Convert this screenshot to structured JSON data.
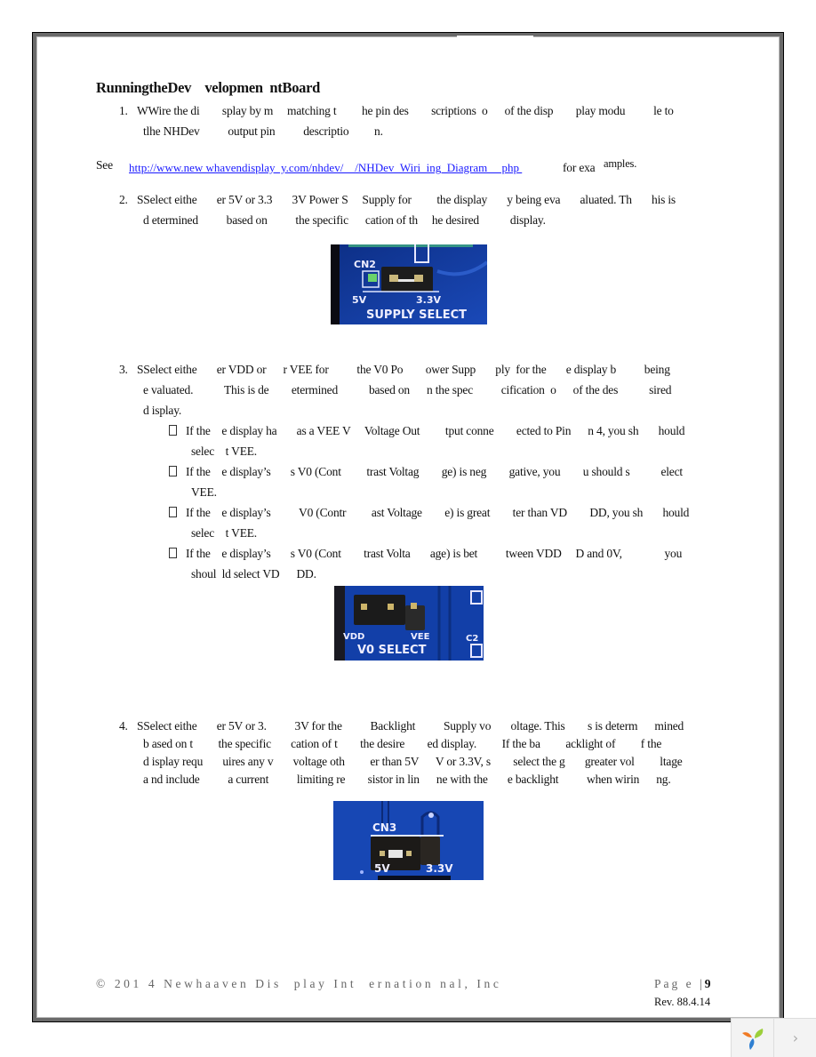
{
  "document": {
    "heading": "RunningtheDev    velopmen  ntBoard",
    "steps": [
      {
        "number": "1.",
        "lines": [
          "WWire the di        splay by m     matching t         he pin des        scriptions  o      of the disp        play modu          le to",
          "tlhe NHDev          output pin          descriptio         n."
        ]
      },
      {
        "number": "2.",
        "lines": [
          "SSelect eithe       er 5V or 3.3       3V Power S     Supply for         the display       y being eva       aluated. Th       his is",
          "d etermined          based on          the specific      cation of th     he desired           display."
        ]
      },
      {
        "number": "3.",
        "lines": [
          "SSelect eithe       er VDD or      r VEE for          the V0 Po        ower Supp       ply  for the       e display b          being",
          "e valuated.           This is de        etermined           based on      n the spec          cification  o      of the des           sired",
          "d isplay."
        ],
        "bullets": [
          {
            "lines": [
              "If the    e display ha       as a VEE V     Voltage Out         tput conne        ected to Pin      n 4, you sh       hould",
              "selec    t VEE."
            ]
          },
          {
            "lines": [
              "If the    e display’s       s V0 (Cont         trast Voltag        ge) is neg        gative, you        u should s           elect",
              "VEE."
            ]
          },
          {
            "lines": [
              "If the    e display’s          V0 (Contr         ast Voltage        e) is great        ter than VD        DD, you sh       hould",
              "selec    t VEE."
            ]
          },
          {
            "lines": [
              "If the    e display’s       s V0 (Cont        trast Volta       age) is bet          tween VDD     D and 0V,               you",
              "shoul  ld select VD      DD."
            ]
          }
        ]
      },
      {
        "number": "4.",
        "lines": [
          "SSelect eithe       er 5V or 3.          3V for the          Backlight          Supply vo       oltage. This        s is determ      mined",
          "b ased on t         the specific       cation of t        the desire        ed display.         If the ba         acklight of         f the",
          "d isplay requ       uires any v       voltage oth         er than 5V      V or 3.3V, s        select the g       greater vol         ltage",
          "a nd include          a current          limiting re        sistor in lin      ne with the       e backlight          when wirin      ng."
        ]
      }
    ],
    "see_line": {
      "prefix": "See",
      "link": "http://www.new whavendisplay  y.com/nhdev/    /NHDev_Wiri  ing_Diagram     php ",
      "suffix_small": "for exa",
      "suffix_raised": "amples."
    },
    "photos": [
      {
        "label_top": "CN2",
        "label_left": "5V",
        "label_right": "3.3V",
        "caption": "SUPPLY SELECT"
      },
      {
        "label_left": "VDD",
        "label_right": "VEE",
        "label_edge": "C2",
        "caption": "V0 SELECT"
      },
      {
        "label_top": "CN3",
        "label_left": "5V",
        "label_right": "3.3V"
      }
    ]
  },
  "footer": {
    "copyright": "© 201 4 Newhaaven Dis  play Int  ernation nal, Inc",
    "page_label": "Pag e |",
    "page_number": "9",
    "revision": "Rev. 88.4.14"
  },
  "viewer": {
    "next_glyph": "›"
  }
}
